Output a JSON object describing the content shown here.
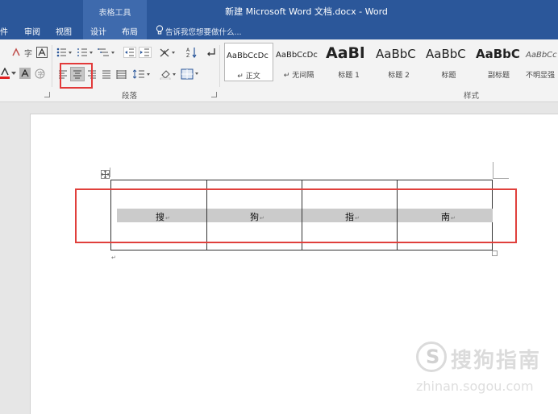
{
  "titlebar": {
    "context_tab": "表格工具",
    "document_title": "新建 Microsoft Word 文档.docx - Word"
  },
  "tabs": [
    {
      "label": "件"
    },
    {
      "label": "审阅"
    },
    {
      "label": "视图"
    },
    {
      "label": "设计"
    },
    {
      "label": "布局"
    }
  ],
  "tell_me": {
    "text": "告诉我您想要做什么..."
  },
  "ribbon": {
    "paragraph_group_label": "段落",
    "styles_group_label": "样式",
    "style_gallery": [
      {
        "sample": "AaBbCcDc",
        "name": "↵ 正文",
        "selected": true
      },
      {
        "sample": "AaBbCcDc",
        "name": "↵ 无间隔",
        "selected": false
      },
      {
        "sample": "AaBl",
        "name": "标题 1",
        "selected": false
      },
      {
        "sample": "AaBbC",
        "name": "标题 2",
        "selected": false
      },
      {
        "sample": "AaBbC",
        "name": "标题",
        "selected": false
      },
      {
        "sample": "AaBbC",
        "name": "副标题",
        "selected": false
      },
      {
        "sample": "AaBbCc",
        "name": "不明显强",
        "selected": false
      }
    ],
    "font_color_accent": "#e02020"
  },
  "document": {
    "table_cells": [
      {
        "text": "搜"
      },
      {
        "text": "狗"
      },
      {
        "text": "指"
      },
      {
        "text": "南"
      }
    ],
    "paragraph_mark": "↵"
  },
  "watermark": {
    "logo_letter": "S",
    "text": "搜狗指南",
    "url": "zhinan.sogou.com"
  },
  "colors": {
    "titlebar": "#2b579a",
    "highlight": "#e0403c"
  }
}
